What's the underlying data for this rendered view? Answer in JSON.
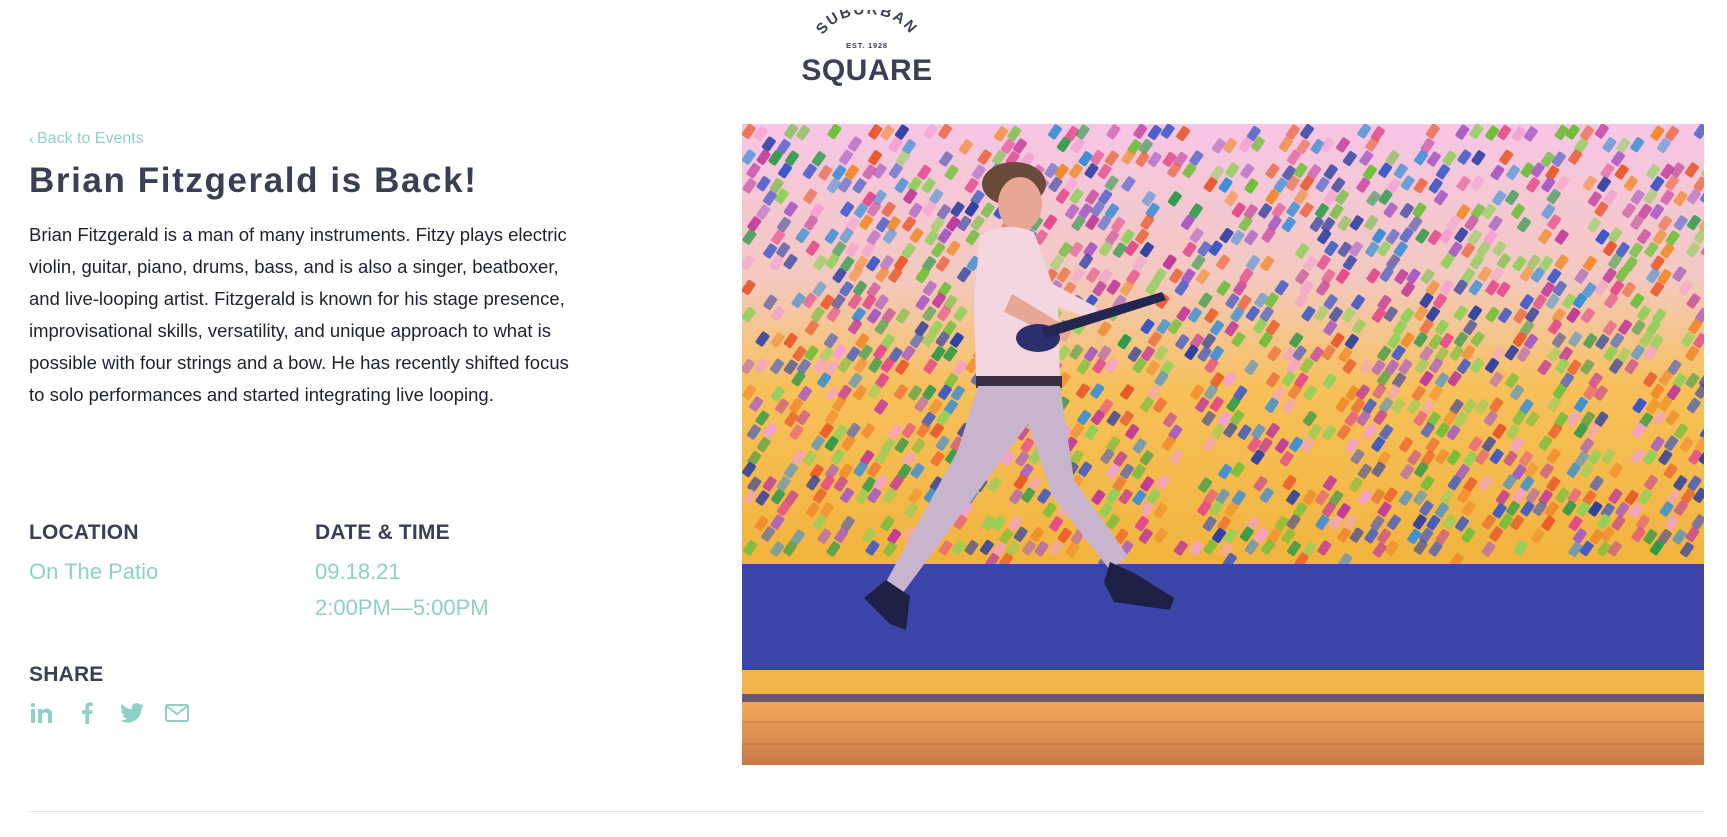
{
  "brand": {
    "arc_text": "SUBURBAN",
    "est_text": "EST. 1928",
    "name": "SQUARE",
    "color": "#3b3f52"
  },
  "nav": {
    "back_label": "Back to Events"
  },
  "event": {
    "title": "Brian Fitzgerald is Back!",
    "description": "Brian Fitzgerald is a man of many instruments. Fitzy plays electric violin, guitar, piano, drums, bass, and is also a singer, beatboxer, and live-looping artist. Fitzgerald is known for his stage presence, improvisational skills, versatility, and unique approach to what is possible with four strings and a bow. He has recently shifted focus to solo performances and started integrating live looping.",
    "location_label": "LOCATION",
    "location_value": "On The Patio",
    "datetime_label": "DATE & TIME",
    "date_value": "09.18.21",
    "time_value": "2:00PM—5:00PM"
  },
  "share": {
    "label": "SHARE",
    "icons": [
      "linkedin-icon",
      "facebook-icon",
      "twitter-icon",
      "email-icon"
    ]
  },
  "colors": {
    "accent": "#8fd0c4",
    "heading": "#3b3f52",
    "body_text": "#1f2230",
    "divider": "#e2e4e8"
  }
}
